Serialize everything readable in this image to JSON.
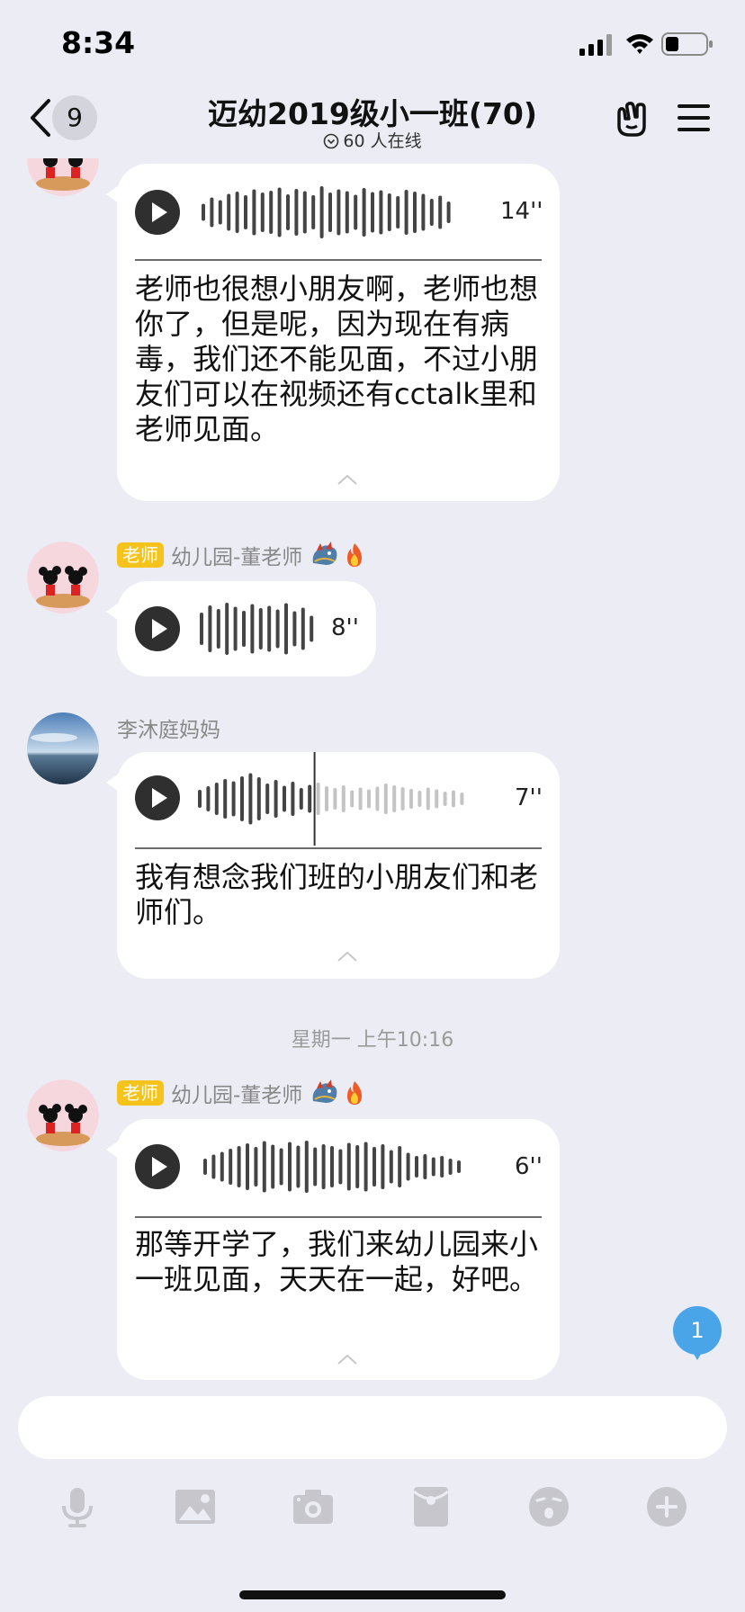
{
  "status_bar": {
    "time": "8:34"
  },
  "nav": {
    "unread_count": "9",
    "title": "迈幼2019级小一班(70)",
    "online": "60 人在线"
  },
  "messages": [
    {
      "duration": "14''",
      "transcript": "老师也很想小朋友啊，老师也想你了，但是呢，因为现在有病毒，我们还不能见面，不过小朋友们可以在视频还有cctalk里和老师见面。"
    },
    {
      "role": "老师",
      "sender": "幼儿园-董老师",
      "duration": "8''"
    },
    {
      "sender": "李沐庭妈妈",
      "duration": "7''",
      "transcript": "我有想念我们班的小朋友们和老师们。"
    },
    {
      "timestamp": "星期一 上午10:16"
    },
    {
      "role": "老师",
      "sender": "幼儿园-董老师",
      "duration": "6''",
      "transcript": "那等开学了，我们来幼儿园来小一班见面，天天在一起，好吧。"
    }
  ],
  "new_message_badge": "1",
  "input": {
    "placeholder": ""
  },
  "toolbar": [
    "microphone-icon",
    "image-icon",
    "camera-icon",
    "red-packet-icon",
    "emoji-icon",
    "plus-icon"
  ],
  "colors": {
    "background": "#ececf4",
    "teacher_badge": "#f5c31b",
    "new_message_badge": "#4aa5e8",
    "bubble": "#ffffff"
  }
}
